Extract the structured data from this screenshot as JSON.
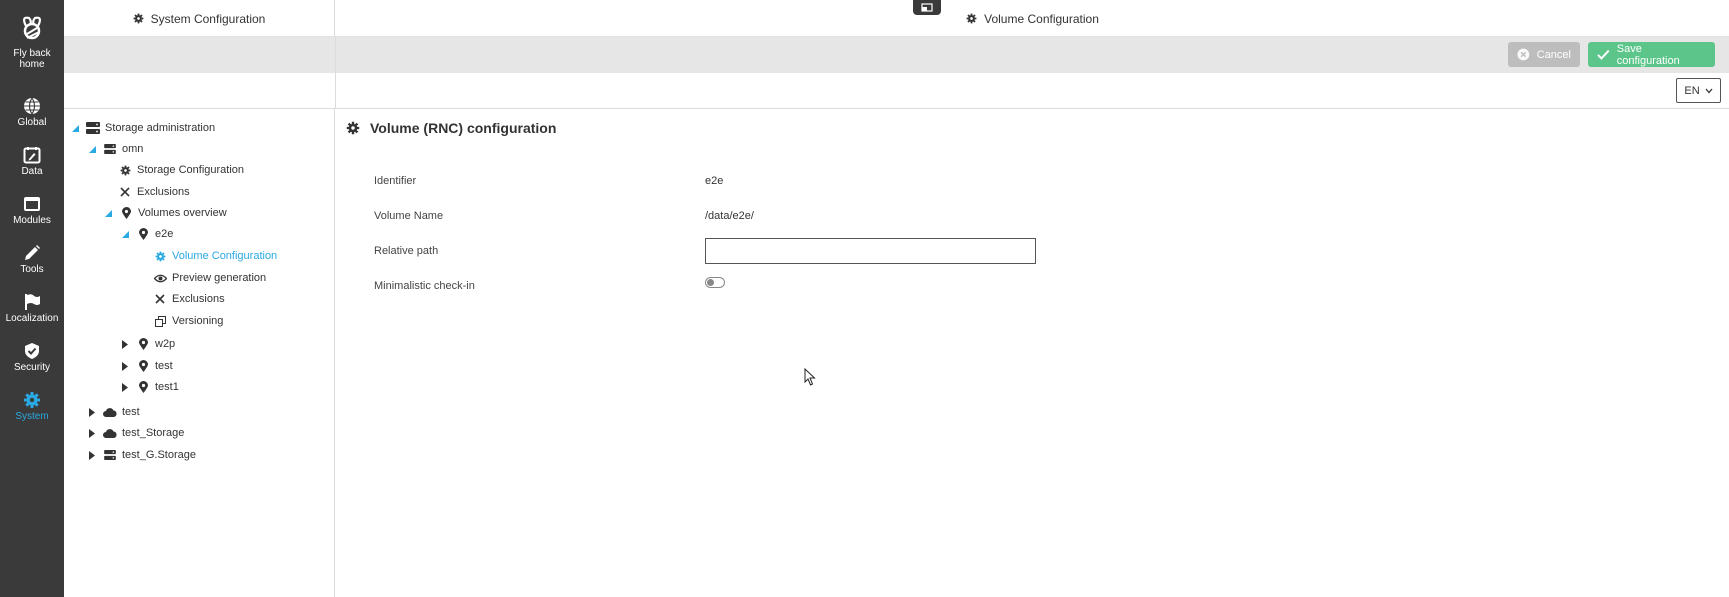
{
  "rail": {
    "items": [
      {
        "label": "Fly back home",
        "icon": "bee-logo-icon"
      },
      {
        "label": "Global",
        "icon": "globe-icon"
      },
      {
        "label": "Data",
        "icon": "calendar-edit-icon"
      },
      {
        "label": "Modules",
        "icon": "window-icon"
      },
      {
        "label": "Tools",
        "icon": "pencil-icon"
      },
      {
        "label": "Localization",
        "icon": "flag-icon"
      },
      {
        "label": "Security",
        "icon": "shield-check-icon"
      },
      {
        "label": "System",
        "icon": "gear-icon",
        "active": true
      }
    ],
    "fly_back_line1": "Fly back",
    "fly_back_line2": "home",
    "global": "Global",
    "data": "Data",
    "modules": "Modules",
    "tools": "Tools",
    "localization": "Localization",
    "security": "Security",
    "system": "System"
  },
  "header": {
    "left_title": "System Configuration",
    "right_title": "Volume Configuration"
  },
  "actions": {
    "cancel_label": "Cancel",
    "save_label": "Save configuration"
  },
  "language": {
    "selected": "EN"
  },
  "tree": {
    "storage_admin": "Storage administration",
    "omn": "omn",
    "storage_configuration": "Storage Configuration",
    "exclusions": "Exclusions",
    "volumes_overview": "Volumes overview",
    "e2e": "e2e",
    "volume_configuration": "Volume Configuration",
    "preview_generation": "Preview generation",
    "e2e_exclusions": "Exclusions",
    "versioning": "Versioning",
    "w2p": "w2p",
    "test": "test",
    "test1": "test1",
    "root_test": "test",
    "test_storage": "test_Storage",
    "test_g_storage": "test_G.Storage"
  },
  "main": {
    "title": "Volume (RNC) configuration",
    "fields": {
      "identifier_label": "Identifier",
      "identifier_value": "e2e",
      "volume_name_label": "Volume Name",
      "volume_name_value": "/data/e2e/",
      "relative_path_label": "Relative path",
      "relative_path_value": "",
      "minimalistic_label": "Minimalistic check-in",
      "minimalistic_on": false
    }
  },
  "colors": {
    "rail_bg": "#3a3a3a",
    "accent": "#29a9e1",
    "save_green": "#5cc58a",
    "cancel_gray": "#bdbdbd"
  }
}
